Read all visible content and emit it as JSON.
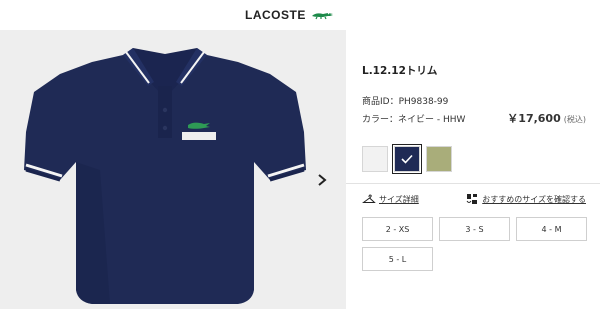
{
  "header": {
    "brand": "LACOSTE",
    "logo_icon": "crocodile-icon",
    "accent": "#1d8a4a"
  },
  "gallery": {
    "background": "#eeeeee",
    "product_color": "#1f2a55",
    "next_icon": "chevron-right-icon"
  },
  "product": {
    "title": "L.12.12トリム",
    "product_id": "商品ID：PH9838-99",
    "color_line": "カラー：ネイビー - HHW",
    "price": "￥17,600",
    "tax_note": "(税込)"
  },
  "swatches": [
    {
      "name": "white",
      "color": "#f2f2f2",
      "selected": false
    },
    {
      "name": "navy",
      "color": "#1f2a55",
      "selected": true
    },
    {
      "name": "khaki",
      "color": "#a9ad7a",
      "selected": false
    }
  ],
  "size_guide": {
    "label": "サイズ詳細",
    "icon": "hanger-icon"
  },
  "recommend": {
    "label": "おすすめのサイズを確認する",
    "icon": "size-advisor-icon"
  },
  "sizes": [
    "2 - XS",
    "3 - S",
    "4 - M",
    "5 - L"
  ]
}
